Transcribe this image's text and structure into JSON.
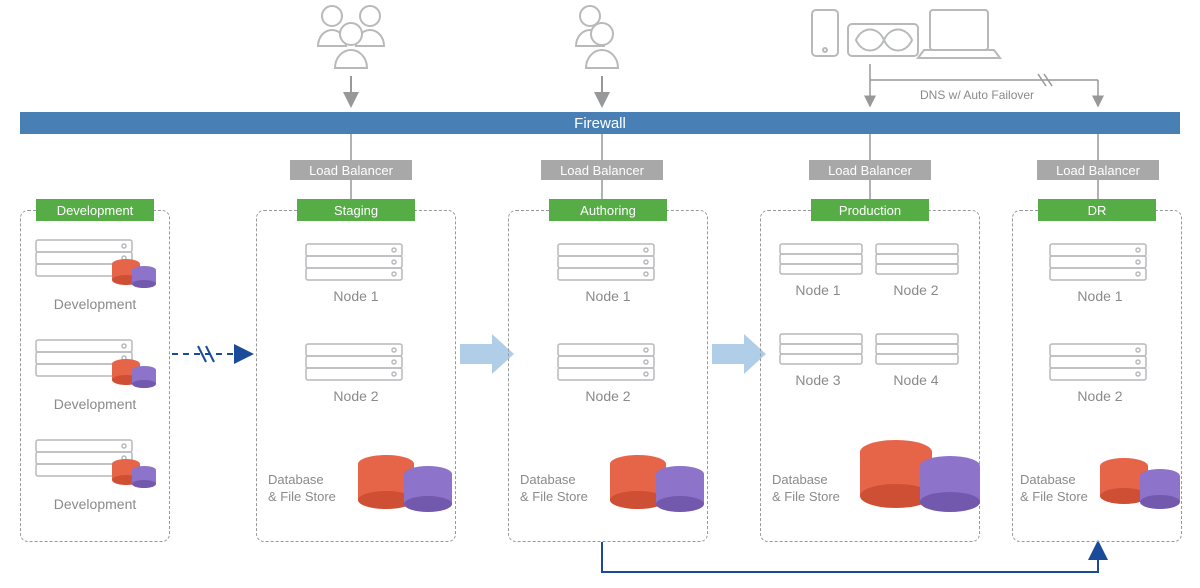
{
  "firewall_label": "Firewall",
  "load_balancer_label": "Load Balancer",
  "dns_label": "DNS w/ Auto Failover",
  "database_label": "Database",
  "filestore_label": "& File Store",
  "environments": {
    "dev": {
      "title": "Development",
      "dev_label": "Development"
    },
    "staging": {
      "title": "Staging",
      "node1": "Node 1",
      "node2": "Node 2"
    },
    "authoring": {
      "title": "Authoring",
      "node1": "Node 1",
      "node2": "Node 2"
    },
    "production": {
      "title": "Production",
      "node1": "Node 1",
      "node2": "Node 2",
      "node3": "Node 3",
      "node4": "Node 4"
    },
    "dr": {
      "title": "DR",
      "node1": "Node 1",
      "node2": "Node 2"
    }
  }
}
